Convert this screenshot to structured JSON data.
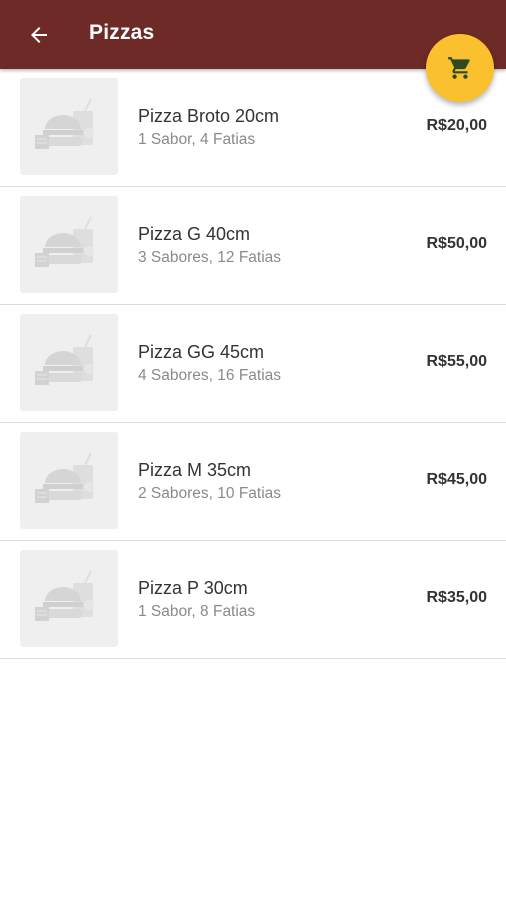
{
  "header": {
    "title": "Pizzas",
    "back_icon": "arrow-left-icon",
    "background": "#6e2a26"
  },
  "cart_fab": {
    "icon": "shopping-cart-icon",
    "background": "#fbc02d",
    "icon_color": "#2e4a20"
  },
  "products": [
    {
      "name": "Pizza Broto 20cm",
      "description": "1 Sabor, 4 Fatias",
      "price": "R$20,00",
      "image_icon": "food-placeholder-icon"
    },
    {
      "name": "Pizza G 40cm",
      "description": "3 Sabores, 12 Fatias",
      "price": "R$50,00",
      "image_icon": "food-placeholder-icon"
    },
    {
      "name": "Pizza GG 45cm",
      "description": "4 Sabores, 16 Fatias",
      "price": "R$55,00",
      "image_icon": "food-placeholder-icon"
    },
    {
      "name": "Pizza M 35cm",
      "description": "2 Sabores, 10 Fatias",
      "price": "R$45,00",
      "image_icon": "food-placeholder-icon"
    },
    {
      "name": "Pizza P 30cm",
      "description": "1 Sabor, 8 Fatias",
      "price": "R$35,00",
      "image_icon": "food-placeholder-icon"
    }
  ]
}
